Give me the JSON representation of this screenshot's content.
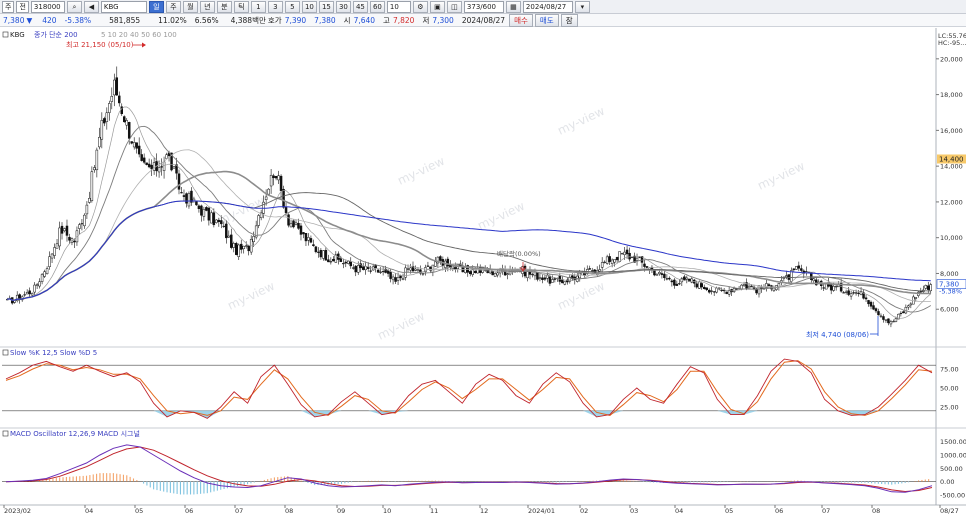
{
  "toolbar": {
    "market_select": "주",
    "code_select": "전",
    "code_value": "318000",
    "name_value": "KBG",
    "search_icon": "magnifier-icon",
    "period_buttons": [
      "주",
      "월",
      "년",
      "분",
      "틱"
    ],
    "interval_buttons": [
      "1",
      "3",
      "5",
      "10",
      "15",
      "30",
      "45",
      "60"
    ],
    "count_value": "10",
    "ratio_value": "373/600",
    "date_value": "2024/08/27"
  },
  "quote": {
    "price": "7,380",
    "change_arrow": "▼",
    "change": "420",
    "change_rate": "-5.38%",
    "volume": "581,855",
    "vol_ratio": "11.02%",
    "turnover_rate": "6.56%",
    "amount": "4,388백만",
    "label_bid": "호가",
    "bid_sell": "7,390",
    "bid_buy": "7,380",
    "label_open": "시",
    "open": "7,640",
    "label_high": "고",
    "high": "7,820",
    "label_low": "저",
    "low": "7,300",
    "date": "2024/08/27",
    "buy_label": "매수",
    "sell_label": "매도",
    "etc_label": "잠"
  },
  "chart_data": [
    {
      "type": "candlestick",
      "legend_price": "KBG",
      "legend_ma": "종가 단순 200",
      "legend_ma_periods": "5 10 20 40 50 60 100",
      "ylim": [
        4000,
        21500
      ],
      "y_ticks": [
        "20,000",
        "18,000",
        "16,000",
        "14,000",
        "12,000",
        "10,000",
        "8,000",
        "6,000"
      ],
      "y_values": [
        20000,
        18000,
        16000,
        14000,
        12000,
        10000,
        8000,
        6000
      ],
      "current_price_label": "7,380",
      "current_change_label": "-5.38%",
      "level_label": "14,400",
      "level_value": 14400,
      "corner_label_1": "LC:55.76",
      "corner_label_2": "HC:-95...",
      "high_annotation": "최고 21,150 (05/10)",
      "high_value": 21150,
      "low_annotation": "최저 4,740 (08/06)",
      "low_value": 4740,
      "event_annotation": "배당락(0.00%)",
      "series_close": [
        6400,
        6700,
        7100,
        8500,
        10500,
        9800,
        12000,
        16000,
        18500,
        16200,
        14000,
        13800,
        14600,
        12500,
        11900,
        11200,
        10700,
        9300,
        9400,
        11800,
        13900,
        11000,
        10200,
        9400,
        8900,
        8700,
        8300,
        8200,
        8100,
        7500,
        8300,
        8000,
        8700,
        8600,
        8100,
        8200,
        8100,
        8100,
        8300,
        8000,
        7800,
        7500,
        7700,
        7900,
        8300,
        8800,
        9100,
        8800,
        8300,
        7800,
        7500,
        7600,
        7300,
        7000,
        7100,
        7400,
        7100,
        7300,
        7600,
        8200,
        7800,
        7300,
        7200,
        7000,
        6800,
        5900,
        5200,
        5900,
        6900,
        7380
      ],
      "watermark": "my-view"
    },
    {
      "type": "line",
      "title": "Slow %K 12,5  Slow %D 5",
      "ylim": [
        0,
        100
      ],
      "y_ticks": [
        "75.00",
        "50.00",
        "25.00"
      ],
      "y_values": [
        75,
        50,
        25
      ],
      "series": [
        {
          "name": "Slow %K",
          "values": [
            62,
            70,
            80,
            85,
            78,
            72,
            80,
            72,
            65,
            70,
            58,
            30,
            12,
            20,
            18,
            10,
            25,
            45,
            30,
            65,
            80,
            55,
            28,
            12,
            15,
            32,
            45,
            30,
            15,
            18,
            40,
            55,
            60,
            45,
            30,
            55,
            68,
            60,
            40,
            30,
            55,
            70,
            58,
            30,
            12,
            15,
            35,
            50,
            35,
            30,
            55,
            78,
            70,
            35,
            15,
            15,
            40,
            72,
            88,
            85,
            70,
            35,
            20,
            14,
            15,
            25,
            42,
            60,
            80,
            70
          ]
        },
        {
          "name": "Slow %D",
          "values": [
            60,
            66,
            75,
            82,
            80,
            74,
            77,
            74,
            68,
            68,
            62,
            40,
            20,
            16,
            18,
            14,
            20,
            38,
            35,
            55,
            74,
            62,
            38,
            18,
            14,
            26,
            40,
            35,
            20,
            17,
            32,
            48,
            58,
            50,
            36,
            48,
            62,
            62,
            48,
            34,
            48,
            64,
            62,
            38,
            18,
            14,
            28,
            44,
            40,
            32,
            48,
            72,
            72,
            45,
            22,
            16,
            32,
            62,
            84,
            86,
            75,
            45,
            25,
            16,
            14,
            20,
            36,
            54,
            74,
            72
          ]
        }
      ]
    },
    {
      "type": "line",
      "title": "MACD Oscillator 12,26,9  MACD  시그널",
      "ylim": [
        -800,
        1900
      ],
      "y_ticks": [
        "1500.00",
        "1000.00",
        "500.00",
        "0.00",
        "-500.00"
      ],
      "y_values": [
        1500,
        1000,
        500,
        0,
        -500
      ],
      "series": [
        {
          "name": "MACD",
          "values": [
            0,
            20,
            50,
            120,
            300,
            500,
            700,
            1000,
            1250,
            1380,
            1300,
            1000,
            700,
            400,
            150,
            -50,
            -150,
            -200,
            -220,
            -150,
            0,
            150,
            100,
            -50,
            -150,
            -200,
            -180,
            -150,
            -120,
            -150,
            -100,
            -60,
            -20,
            -10,
            -40,
            -30,
            -20,
            -30,
            -10,
            -30,
            -60,
            -90,
            -80,
            -50,
            0,
            60,
            100,
            80,
            40,
            -20,
            -60,
            -80,
            -100,
            -120,
            -110,
            -90,
            -100,
            -90,
            -60,
            0,
            -10,
            -50,
            -80,
            -110,
            -150,
            -250,
            -380,
            -400,
            -300,
            -150
          ]
        },
        {
          "name": "시그널",
          "values": [
            0,
            10,
            30,
            80,
            200,
            380,
            560,
            800,
            1050,
            1230,
            1300,
            1180,
            950,
            700,
            450,
            220,
            40,
            -80,
            -160,
            -170,
            -100,
            20,
            80,
            30,
            -70,
            -150,
            -180,
            -170,
            -140,
            -140,
            -120,
            -80,
            -45,
            -25,
            -35,
            -32,
            -25,
            -28,
            -18,
            -25,
            -45,
            -70,
            -78,
            -62,
            -25,
            25,
            70,
            78,
            55,
            10,
            -35,
            -65,
            -85,
            -105,
            -108,
            -98,
            -98,
            -92,
            -74,
            -30,
            -18,
            -38,
            -62,
            -90,
            -125,
            -200,
            -310,
            -370,
            -330,
            -220
          ]
        }
      ]
    }
  ],
  "x_axis_labels": [
    "2023/02",
    "04",
    "05",
    "06",
    "07",
    "08",
    "09",
    "10",
    "11",
    "12",
    "2024/01",
    "02",
    "03",
    "04",
    "05",
    "06",
    "07",
    "08",
    "08/27"
  ]
}
